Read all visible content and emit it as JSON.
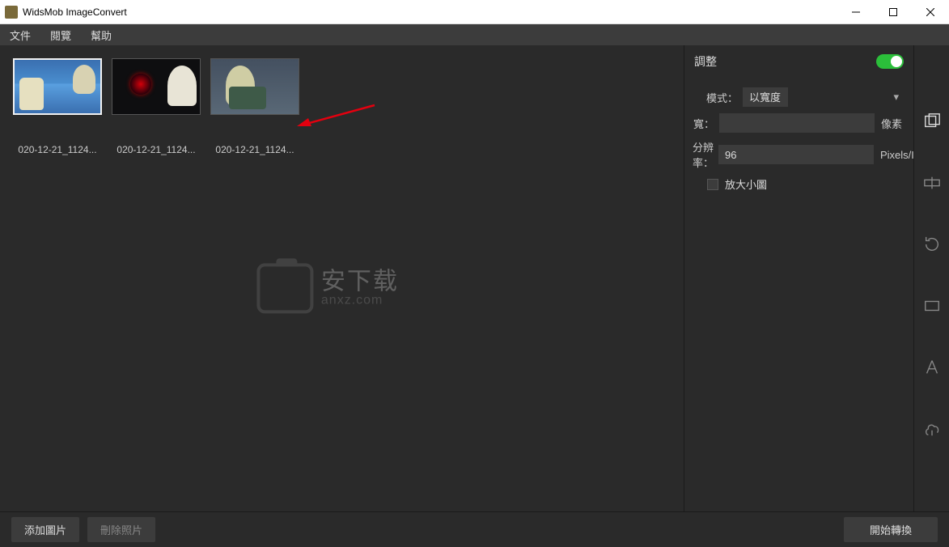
{
  "app": {
    "title": "WidsMob ImageConvert"
  },
  "menu": {
    "file": "文件",
    "view": "閱覽",
    "help": "幫助"
  },
  "thumbs": [
    {
      "label": "020-12-21_1124..."
    },
    {
      "label": "020-12-21_1124..."
    },
    {
      "label": "020-12-21_1124..."
    }
  ],
  "watermark": {
    "big": "安下载",
    "small": "anxz.com"
  },
  "panel": {
    "title": "調整",
    "mode_label": "模式：",
    "mode_value": "以寬度",
    "width_label": "寬：",
    "width_value": "",
    "width_unit": "像素",
    "res_label": "分辨率：",
    "res_value": "96",
    "res_unit": "Pixels/Inch",
    "enlarge_label": "放大小圖"
  },
  "footer": {
    "add": "添加圖片",
    "delete": "刪除照片",
    "convert": "開始轉換"
  }
}
